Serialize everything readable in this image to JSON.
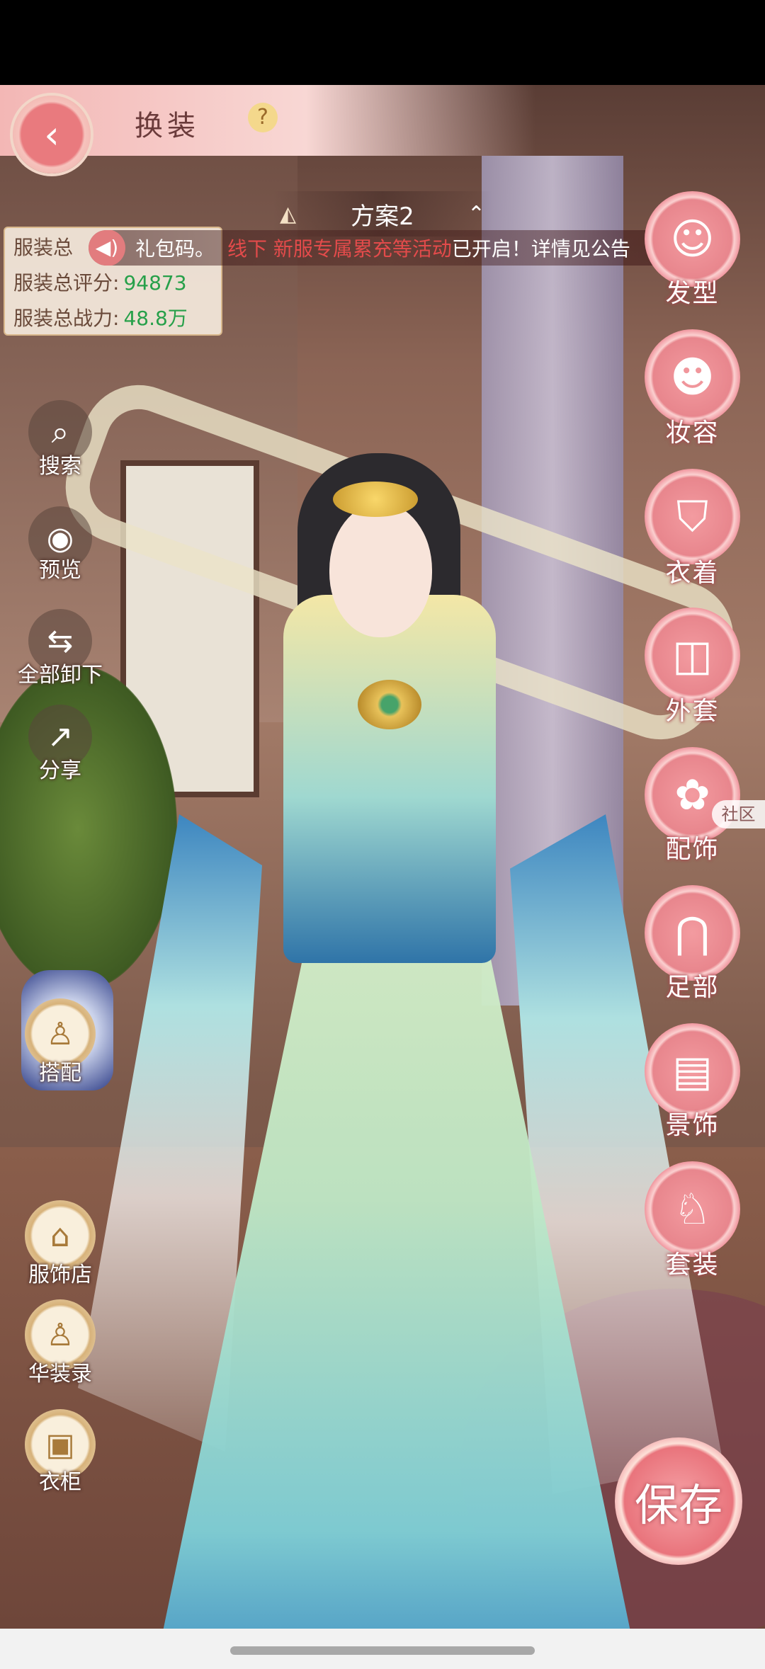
{
  "header": {
    "title": "换装",
    "help_icon": "?"
  },
  "scheme": {
    "name": "方案2",
    "left_icon": "◭",
    "right_icon": "⌃"
  },
  "stats": {
    "items": [
      {
        "label": "服装总",
        "value": ""
      },
      {
        "label": "服装总评分:",
        "value": "94873"
      },
      {
        "label": "服装总战力:",
        "value": "48.8万"
      }
    ]
  },
  "ticker": {
    "part1": "礼包码。",
    "part2": "线下 新服专属累充等活动",
    "part3": "已开启！详情见公告"
  },
  "left_menu": [
    {
      "label": "搜索",
      "icon": "search-icon"
    },
    {
      "label": "预览",
      "icon": "eye-icon"
    },
    {
      "label": "全部卸下",
      "icon": "unequip-icon"
    },
    {
      "label": "分享",
      "icon": "share-icon"
    }
  ],
  "left_gold_menu": [
    {
      "label": "搭配",
      "icon": "outfit-icon"
    },
    {
      "label": "服饰店",
      "icon": "shop-icon"
    },
    {
      "label": "华装录",
      "icon": "collection-icon"
    },
    {
      "label": "衣柜",
      "icon": "wardrobe-icon"
    }
  ],
  "right_menu": [
    {
      "label": "发型",
      "icon": "hair-icon"
    },
    {
      "label": "妆容",
      "icon": "makeup-icon"
    },
    {
      "label": "衣着",
      "icon": "clothes-icon"
    },
    {
      "label": "外套",
      "icon": "coat-icon"
    },
    {
      "label": "配饰",
      "icon": "accessory-icon"
    },
    {
      "label": "足部",
      "icon": "shoes-icon"
    },
    {
      "label": "景饰",
      "icon": "scene-icon"
    },
    {
      "label": "套装",
      "icon": "suit-icon"
    }
  ],
  "community": "社区",
  "save_label": "保存"
}
